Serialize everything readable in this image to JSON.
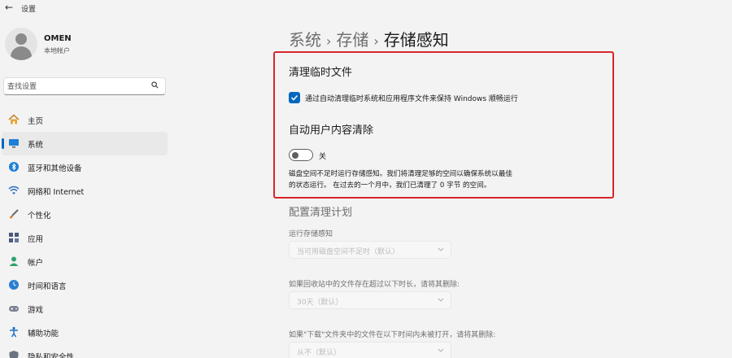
{
  "window": {
    "title": "设置"
  },
  "user": {
    "name": "OMEN",
    "account_type": "本地帐户"
  },
  "search": {
    "placeholder": "查找设置"
  },
  "sidebar": {
    "items": [
      {
        "label": "主页",
        "icon": "home-icon"
      },
      {
        "label": "系统",
        "icon": "monitor-icon",
        "active": true
      },
      {
        "label": "蓝牙和其他设备",
        "icon": "bluetooth-icon"
      },
      {
        "label": "网络和 Internet",
        "icon": "wifi-icon"
      },
      {
        "label": "个性化",
        "icon": "paintbrush-icon"
      },
      {
        "label": "应用",
        "icon": "apps-icon"
      },
      {
        "label": "帐户",
        "icon": "person-icon"
      },
      {
        "label": "时间和语言",
        "icon": "globe-clock-icon"
      },
      {
        "label": "游戏",
        "icon": "gamepad-icon"
      },
      {
        "label": "辅助功能",
        "icon": "accessibility-icon"
      },
      {
        "label": "隐私和安全性",
        "icon": "shield-icon"
      }
    ]
  },
  "breadcrumb": {
    "level1": "系统",
    "level2": "存储",
    "current": "存储感知",
    "separator": "›"
  },
  "temp_files": {
    "title": "清理临时文件",
    "checkbox_label": "通过自动清理临时系统和应用程序文件来保持 Windows 顺畅运行",
    "checked": true
  },
  "auto_cleanup": {
    "title": "自动用户内容清除",
    "toggle_state": "关",
    "description_line1": "磁盘空间不足时运行存储感知。我们将清理足够的空间以确保系统以最佳",
    "description_line2": "的状态运行。 在过去的一个月中，我们已清理了 0 字节 的空间。"
  },
  "schedule": {
    "title": "配置清理计划",
    "run_label": "运行存储感知",
    "run_value": "当可用磁盘空间不足时（默认）",
    "recycle_label": "如果回收站中的文件存在超过以下时长，请将其删除:",
    "recycle_value": "30天（默认）",
    "downloads_label": "如果\"下载\"文件夹中的文件在以下时间内未被打开，请将其删除:",
    "downloads_value": "从不（默认）"
  },
  "colors": {
    "accent": "#0067c0",
    "highlight": "#d8262b"
  }
}
